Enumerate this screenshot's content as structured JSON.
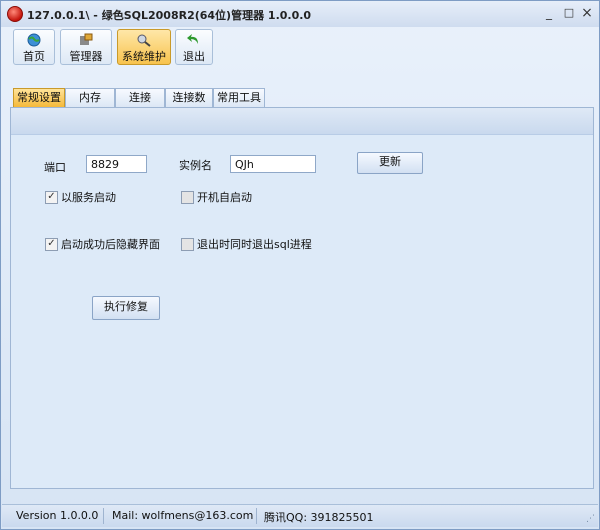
{
  "window": {
    "title": "127.0.0.1\\ - 绿色SQL2008R2(64位)管理器 1.0.0.0",
    "minimize": "_",
    "maximize": "□",
    "close": "×"
  },
  "toolbar": {
    "items": [
      {
        "label": "首页",
        "icon": "globe-icon",
        "active": false
      },
      {
        "label": "管理器",
        "icon": "tools-icon",
        "active": false
      },
      {
        "label": "系统维护",
        "icon": "maintenance-icon",
        "active": true
      },
      {
        "label": "退出",
        "icon": "exit-arrow-icon",
        "active": false
      }
    ]
  },
  "tabs": [
    {
      "label": "常规设置",
      "active": true
    },
    {
      "label": "内存",
      "active": false
    },
    {
      "label": "连接",
      "active": false
    },
    {
      "label": "连接数",
      "active": false
    },
    {
      "label": "常用工具",
      "active": false
    }
  ],
  "form": {
    "port_label": "端口",
    "port_value": "8829",
    "instance_label": "实例名",
    "instance_value": "QJh",
    "update_button": "更新",
    "run_as_service": {
      "label": "以服务启动",
      "checked": true
    },
    "auto_start": {
      "label": "开机自启动",
      "checked": false
    },
    "hide_after_start": {
      "label": "启动成功后隐藏界面",
      "checked": true
    },
    "quit_sql_on_exit": {
      "label": "退出时同时退出sql进程",
      "checked": false
    },
    "repair_button": "执行修复"
  },
  "status": {
    "version": "Version 1.0.0.0",
    "mail": "Mail: wolfmens@163.com",
    "qq": "腾讯QQ: 391825501"
  }
}
